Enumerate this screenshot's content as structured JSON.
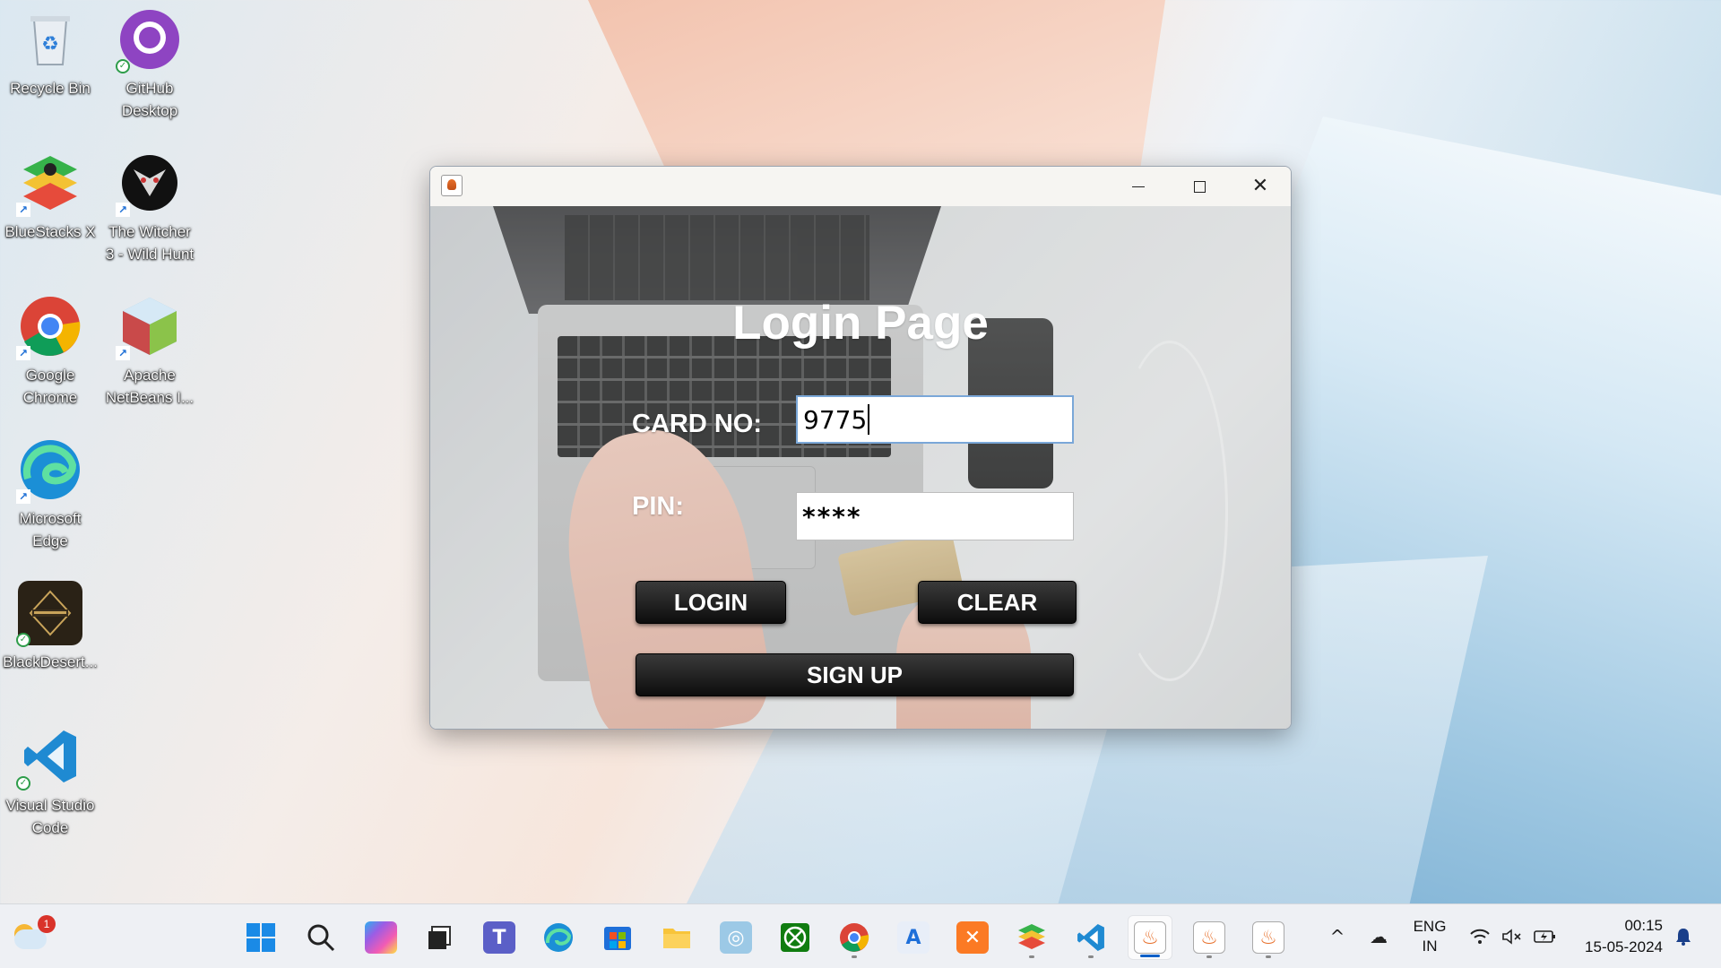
{
  "desktop": {
    "icons": [
      {
        "label": "Recycle Bin",
        "icon": "recycle-bin-icon"
      },
      {
        "label": "GitHub Desktop",
        "icon": "github-desktop-icon"
      },
      {
        "label": "BlueStacks X",
        "icon": "bluestacks-icon"
      },
      {
        "label": "The Witcher 3 - Wild Hunt",
        "icon": "witcher-icon"
      },
      {
        "label": "Google Chrome",
        "icon": "chrome-icon"
      },
      {
        "label": "Apache NetBeans I...",
        "icon": "netbeans-icon"
      },
      {
        "label": "Microsoft Edge",
        "icon": "edge-icon"
      },
      {
        "label": "BlackDesert...",
        "icon": "black-desert-icon"
      },
      {
        "label": "Visual Studio Code",
        "icon": "vscode-icon"
      }
    ]
  },
  "window": {
    "title": "",
    "controls": {
      "minimize": "—",
      "maximize": "☐",
      "close": "✕"
    }
  },
  "login": {
    "heading": "Login Page",
    "card_label": "CARD NO:",
    "card_value": "9775",
    "pin_label": "PIN:",
    "pin_value": "****",
    "login_button": "LOGIN",
    "clear_button": "CLEAR",
    "signup_button": "SIGN UP"
  },
  "taskbar": {
    "weather_badge": "1",
    "apps": [
      "start",
      "search",
      "copilot",
      "task-view",
      "teams",
      "edge",
      "store",
      "file-explorer",
      "remote",
      "xbox",
      "chrome",
      "appstore",
      "xampp",
      "bluestacks",
      "vscode",
      "java-1",
      "java-2",
      "java-3"
    ],
    "language": {
      "line1": "ENG",
      "line2": "IN"
    },
    "clock": {
      "time": "00:15",
      "date": "15-05-2024"
    }
  },
  "colors": {
    "button_bg": "#1a1a1a",
    "button_text": "#ffffff",
    "accent": "#0a5fc7"
  }
}
